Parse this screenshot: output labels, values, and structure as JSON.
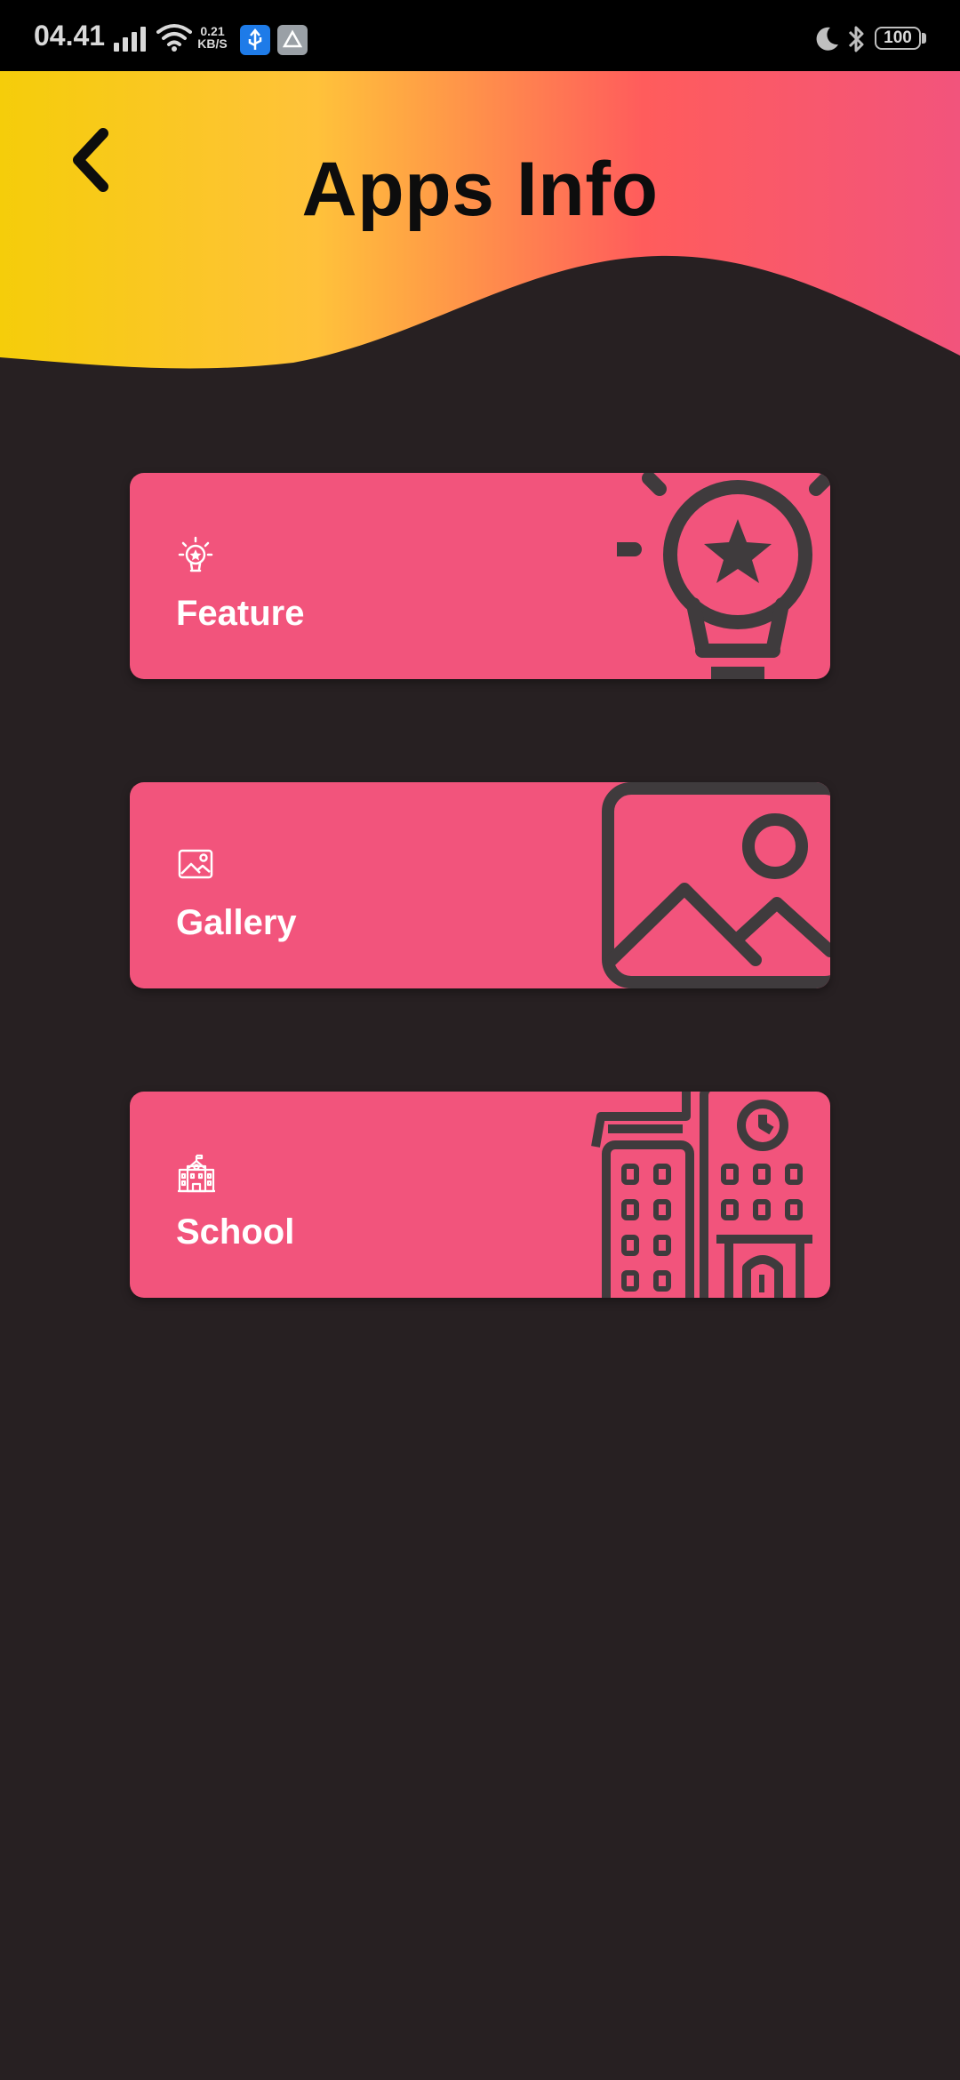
{
  "status_bar": {
    "time": "04.41",
    "speed_value": "0.21",
    "speed_unit": "KB/S",
    "battery": "100"
  },
  "header": {
    "title": "Apps Info",
    "back_icon": "chevron-left-icon",
    "gradient": [
      "#f5cd0a",
      "#ffc23a",
      "#ff5c5c",
      "#f2547c"
    ]
  },
  "cards": [
    {
      "label": "Feature",
      "icon": "lightbulb-star-icon"
    },
    {
      "label": "Gallery",
      "icon": "image-icon"
    },
    {
      "label": "School",
      "icon": "school-building-icon"
    }
  ],
  "colors": {
    "background": "#272022",
    "card": "#f2547c",
    "card_art": "#3f3b3d"
  }
}
